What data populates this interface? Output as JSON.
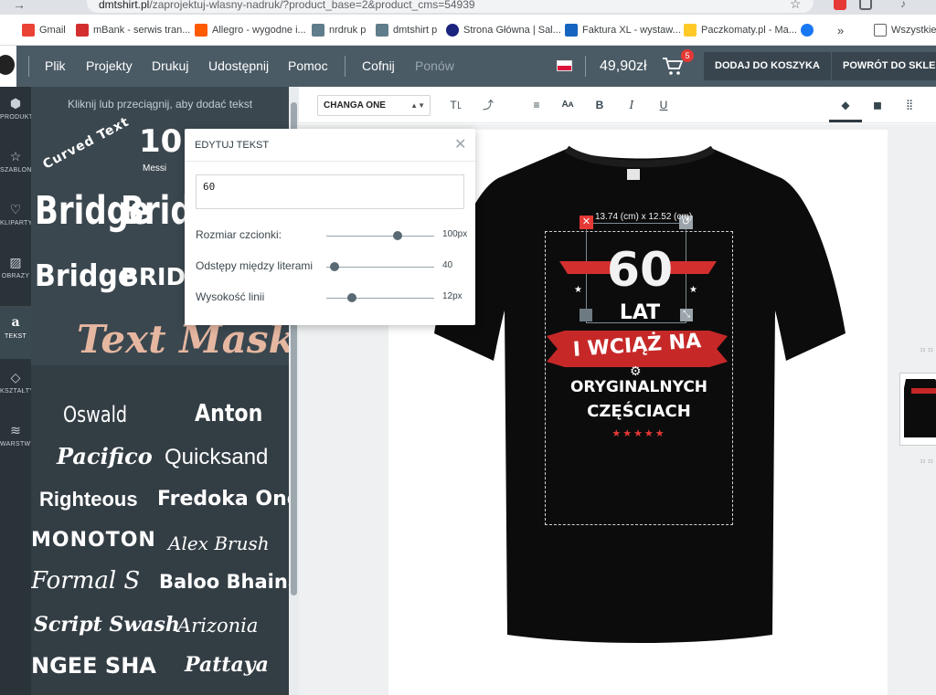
{
  "browser": {
    "url_host": "dmtshirt.pl",
    "url_path": "/zaprojektuj-wlasny-nadruk/?product_base=2&product_cms=54939",
    "bookmarks": [
      {
        "label": "Gmail",
        "color": "#ea4335"
      },
      {
        "label": "mBank - serwis tran...",
        "color": "#d32f2f"
      },
      {
        "label": "Allegro - wygodne i...",
        "color": "#ff5a00"
      },
      {
        "label": "nrdruk p",
        "color": "#607d8b"
      },
      {
        "label": "dmtshirt p",
        "color": "#607d8b"
      },
      {
        "label": "Strona Główna | Sal...",
        "color": "#1a237e"
      },
      {
        "label": "Faktura XL - wystaw...",
        "color": "#1565c0"
      },
      {
        "label": "Paczkomaty.pl - Ma...",
        "color": "#ffca28"
      },
      {
        "label": "",
        "color": "#1877f2"
      }
    ],
    "more_label": "»",
    "all_bookmarks_label": "Wszystkie z"
  },
  "header": {
    "menu": [
      "Plik",
      "Projekty",
      "Drukuj",
      "Udostępnij",
      "Pomoc"
    ],
    "undo_label": "Cofnij",
    "redo_label": "Ponów",
    "price": "49,90zł",
    "cart_count": "5",
    "add_to_cart_label": "DODAJ DO KOSZYKA",
    "back_to_shop_label": "POWRÓT DO SKLEPU"
  },
  "rail": [
    {
      "label": "PRODUKT",
      "icon": "cube-icon",
      "glyph": "⬢"
    },
    {
      "label": "SZABLONY",
      "icon": "star-icon",
      "glyph": "☆"
    },
    {
      "label": "KLIPARTY",
      "icon": "heart-icon",
      "glyph": "♡"
    },
    {
      "label": "OBRAZY",
      "icon": "image-icon",
      "glyph": "▨"
    },
    {
      "label": "TEKST",
      "icon": "text-icon",
      "glyph": "a"
    },
    {
      "label": "KSZTAŁTY",
      "icon": "diamond-icon",
      "glyph": "◇"
    },
    {
      "label": "WARSTWY",
      "icon": "layers-icon",
      "glyph": "≋"
    }
  ],
  "panel": {
    "hint": "Kliknij lub przeciągnij, aby dodać tekst",
    "styles": {
      "curved": "Curved Text",
      "number": "10",
      "number_sub": "Messi",
      "bridge_1": "Bridge",
      "bridge_2": "Brid",
      "bridge_3": "Bridge",
      "bridge_4": "BRIDG",
      "mask": "Text Mask"
    },
    "fonts": [
      "Oswald",
      "Anton",
      "Pacifico",
      "Quicksand",
      "Righteous",
      "Fredoka One",
      "Monoton",
      "Alex Brush",
      "Formal S",
      "Baloo Bhaina",
      "Script Swash",
      "Arizonia",
      "NGEE SHA",
      "Pattaya"
    ]
  },
  "toolbar": {
    "font_name": "CHANGA ONE"
  },
  "popup": {
    "title": "EDYTUJ TEKST",
    "text_value": "60",
    "sliders": [
      {
        "label": "Rozmiar czcionki:",
        "value": "100px",
        "position": 0.66
      },
      {
        "label": "Odstępy między literami",
        "value": "40",
        "position": 0.08
      },
      {
        "label": "Wysokość linii",
        "value": "12px",
        "position": 0.24
      }
    ]
  },
  "design": {
    "dimensions": "13.74 (cm) x 12.52 (cm)",
    "line1": "60",
    "line2": "LAT",
    "line3": "I WCIĄŻ NA",
    "line4": "ORYGINALNYCH",
    "line5": "CZĘŚCIACH"
  }
}
